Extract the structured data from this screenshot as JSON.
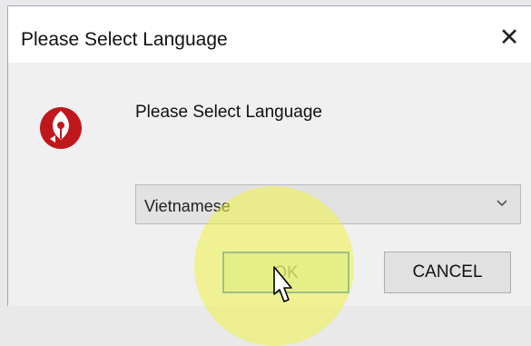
{
  "window": {
    "title": "Please Select Language",
    "close_glyph": "✕"
  },
  "dialog": {
    "prompt": "Please Select Language",
    "icon": "app-logo-icon",
    "language_select": {
      "value": "Vietnamese",
      "icon": "chevron-down-icon"
    },
    "buttons": {
      "ok_label": "OK",
      "cancel_label": "CANCEL"
    }
  },
  "colors": {
    "logo_red": "#c0171d",
    "highlight_yellow": "#f1f346",
    "focus_blue": "#3a7fd0"
  }
}
